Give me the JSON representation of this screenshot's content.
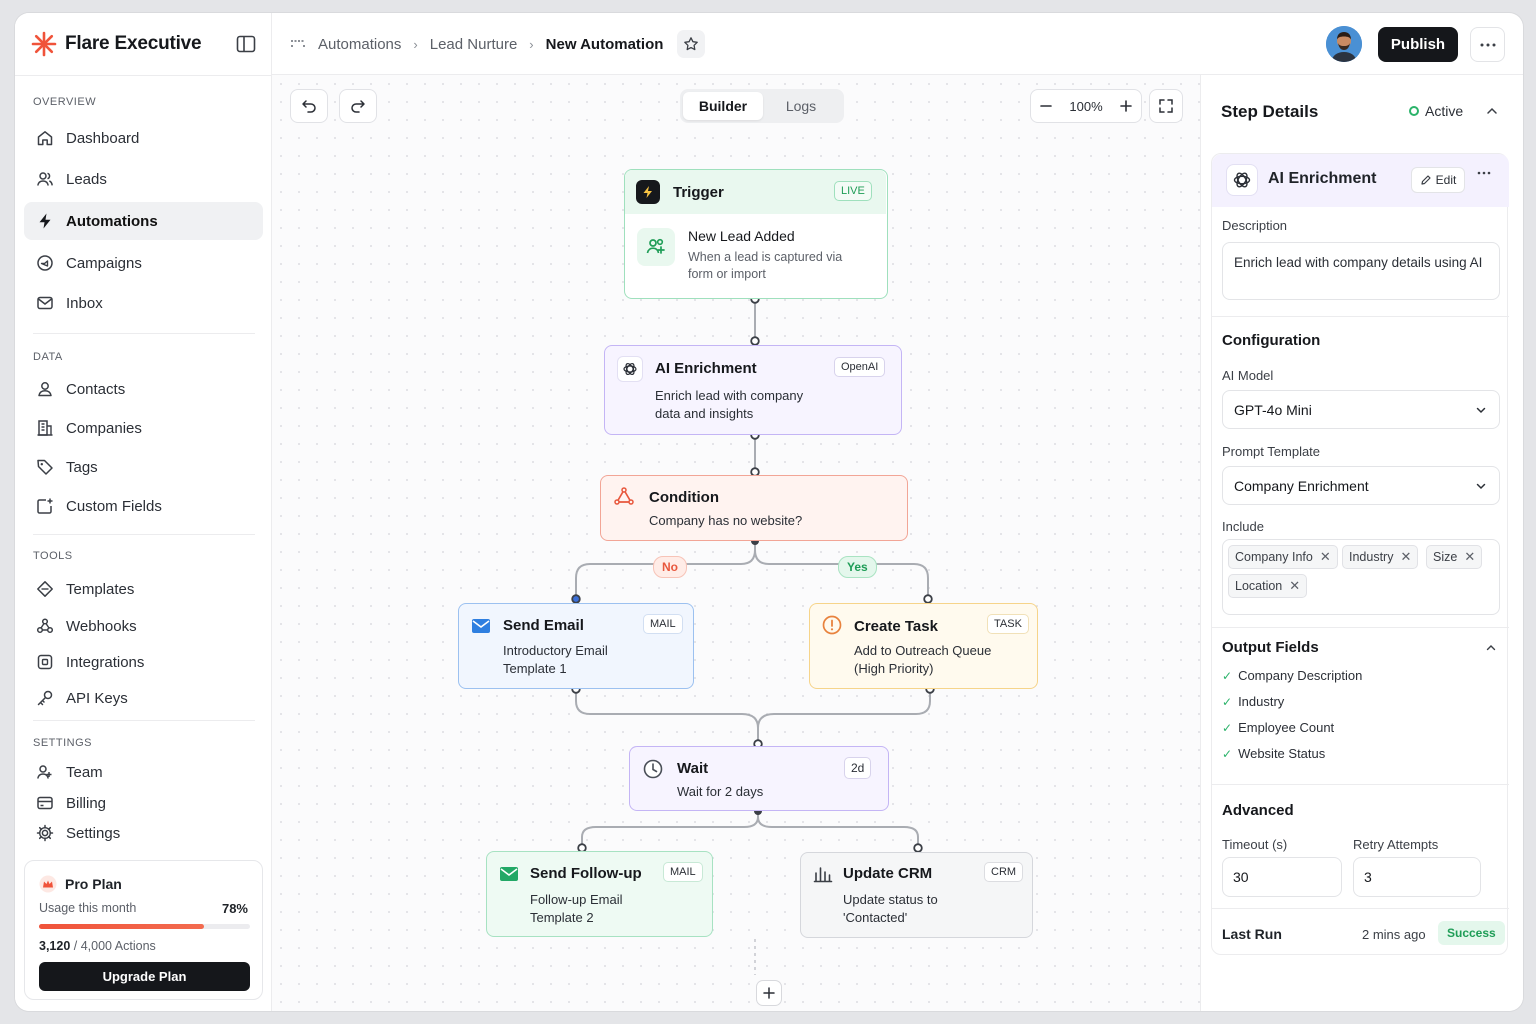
{
  "app": {
    "brand": "Flare Executive",
    "brand_color": "#f0533a"
  },
  "sidebar": {
    "sections": [
      {
        "label": "OVERVIEW"
      },
      {
        "label": "DATA"
      },
      {
        "label": "TOOLS"
      },
      {
        "label": "SETTINGS"
      }
    ],
    "items": [
      {
        "label": "Dashboard",
        "icon": "home-icon"
      },
      {
        "label": "Leads",
        "icon": "users-icon"
      },
      {
        "label": "Automations",
        "icon": "bolt-icon",
        "active": true
      },
      {
        "label": "Campaigns",
        "icon": "megaphone-icon"
      },
      {
        "label": "Inbox",
        "icon": "mail-icon"
      },
      {
        "label": "Contacts",
        "icon": "contact-icon"
      },
      {
        "label": "Companies",
        "icon": "building-icon"
      },
      {
        "label": "Tags",
        "icon": "tag-icon"
      },
      {
        "label": "Custom Fields",
        "icon": "custom-fields-icon"
      },
      {
        "label": "Templates",
        "icon": "template-icon"
      },
      {
        "label": "Webhooks",
        "icon": "webhook-icon"
      },
      {
        "label": "Integrations",
        "icon": "integrations-icon"
      },
      {
        "label": "API Keys",
        "icon": "key-icon"
      },
      {
        "label": "Team",
        "icon": "team-icon"
      },
      {
        "label": "Billing",
        "icon": "billing-icon"
      },
      {
        "label": "Settings",
        "icon": "gear-icon"
      }
    ],
    "plan": {
      "name": "Pro Plan",
      "usage_label": "Usage this month",
      "usage_percent_text": "78%",
      "usage_fraction": 0.78,
      "used": "3,120",
      "total": "/ 4,000 Actions",
      "upgrade_label": "Upgrade Plan"
    }
  },
  "topbar": {
    "breadcrumbs": [
      "Automations",
      "Lead Nurture",
      "New Automation"
    ],
    "publish_label": "Publish"
  },
  "canvas": {
    "tabs": [
      "Builder",
      "Logs"
    ],
    "selected_tab": "Builder",
    "zoom": "100%",
    "nodes": {
      "trigger": {
        "title": "Trigger",
        "badge": "LIVE",
        "subtitle": "New Lead Added",
        "desc": "When a lead is captured via form or import"
      },
      "ai": {
        "title": "AI Enrichment",
        "badge": "OpenAI",
        "desc": "Enrich lead with company data and insights"
      },
      "condition": {
        "title": "Condition",
        "desc": "Company has no website?"
      },
      "send_email": {
        "title": "Send Email",
        "badge": "MAIL",
        "desc": "Introductory Email Template 1"
      },
      "create_task": {
        "title": "Create Task",
        "badge": "TASK",
        "desc": "Add to Outreach Queue (High Priority)"
      },
      "wait": {
        "title": "Wait",
        "badge": "2d",
        "desc": "Wait for 2 days"
      },
      "follow_up": {
        "title": "Send Follow-up",
        "badge": "MAIL",
        "desc": "Follow-up Email Template 2"
      },
      "update_crm": {
        "title": "Update CRM",
        "badge": "CRM",
        "desc": "Update status to 'Contacted'"
      }
    },
    "edge_labels": {
      "no": "No",
      "yes": "Yes"
    }
  },
  "panel": {
    "title": "Step Details",
    "status": "Active",
    "step_title": "AI Enrichment",
    "edit_label": "Edit",
    "description_label": "Description",
    "description": "Enrich lead with company details using AI",
    "configuration_label": "Configuration",
    "ai_model_label": "AI Model",
    "ai_model": "GPT-4o Mini",
    "prompt_label": "Prompt Template",
    "prompt": "Company Enrichment",
    "include_label": "Include",
    "include": [
      "Company Info",
      "Industry",
      "Size",
      "Location"
    ],
    "output_label": "Output Fields",
    "outputs": [
      "Company Description",
      "Industry",
      "Employee Count",
      "Website Status"
    ],
    "advanced_label": "Advanced",
    "timeout_label": "Timeout (s)",
    "timeout": "30",
    "retry_label": "Retry Attempts",
    "retry": "3",
    "last_run_label": "Last Run",
    "last_run": "2 mins ago",
    "last_status": "Success"
  }
}
